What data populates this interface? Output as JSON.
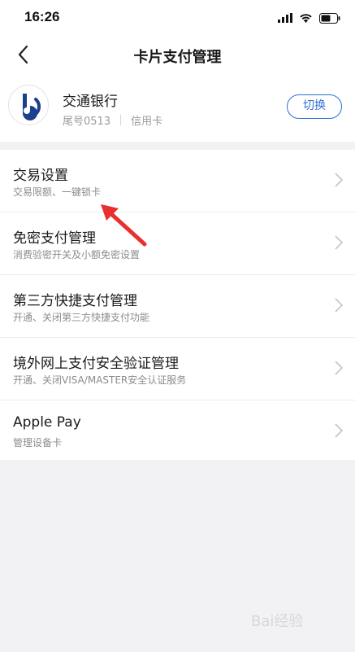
{
  "status_bar": {
    "time": "16:26"
  },
  "nav": {
    "title": "卡片支付管理"
  },
  "card": {
    "bank_name": "交通银行",
    "card_tail": "尾号0513",
    "card_type": "信用卡",
    "switch_label": "切换"
  },
  "menu": {
    "items": [
      {
        "title": "交易设置",
        "subtitle": "交易限额、一键锁卡"
      },
      {
        "title": "免密支付管理",
        "subtitle": "消费验密开关及小额免密设置"
      },
      {
        "title": "第三方快捷支付管理",
        "subtitle": "开通、关闭第三方快捷支付功能"
      },
      {
        "title": "境外网上支付安全验证管理",
        "subtitle": "开通、关闭VISA/MASTER安全认证服务"
      },
      {
        "title": "Apple Pay",
        "subtitle": "管理设备卡"
      }
    ]
  },
  "colors": {
    "accent": "#2f6fd6",
    "bank_logo": "#1d3f8f",
    "arrow": "#e8312f"
  },
  "watermark": {
    "text": "Bai经验"
  }
}
